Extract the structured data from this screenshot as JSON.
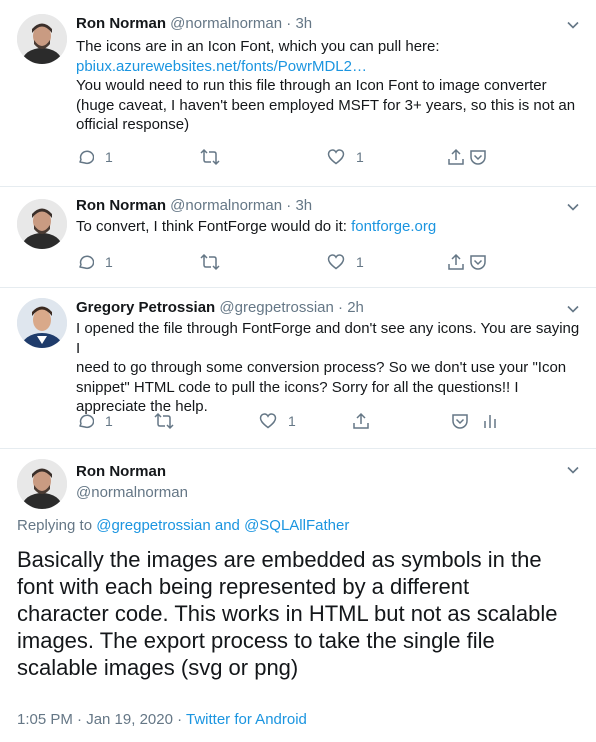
{
  "colors": {
    "link": "#1b95e0",
    "muted": "#657786",
    "text": "#14171a",
    "divider": "#e6ecf0"
  },
  "tweets": [
    {
      "name": "Ron Norman",
      "handle": "@normalnorman",
      "time": "3h",
      "lines": [
        "The icons are in an Icon Font, which you can pull here:",
        "pbiux.azurewebsites.net/fonts/PowrMDL2…",
        "You would need to run this file through an Icon Font to image converter",
        "(huge caveat, I haven't been employed MSFT for 3+ years, so this is not an",
        "official response)"
      ],
      "reply_count": "1",
      "like_count": "1"
    },
    {
      "name": "Ron Norman",
      "handle": "@normalnorman",
      "time": "3h",
      "text_prefix": "To convert, I think FontForge would do it: ",
      "link": "fontforge.org",
      "reply_count": "1",
      "like_count": "1"
    },
    {
      "name": "Gregory Petrossian",
      "handle": "@gregpetrossian",
      "time": "2h",
      "lines": [
        "I opened the file through FontForge and don't see any icons. You are saying I",
        "need to go through some conversion process? So we don't use your \"Icon",
        "snippet\" HTML code to pull the icons? Sorry for all the questions!! I",
        "appreciate the help."
      ],
      "reply_count": "1",
      "like_count": "1"
    }
  ],
  "main_tweet": {
    "name": "Ron Norman",
    "handle": "@normalnorman",
    "replying_prefix": "Replying to ",
    "reply_to_1": "@gregpetrossian",
    "reply_and": " and ",
    "reply_to_2": "@SQLAllFather",
    "lines": [
      "Basically the images are embedded as symbols in the",
      "font with each being represented by a different",
      "character code.  This works in HTML but not as scalable",
      "images.  The export process to take the single file",
      "scalable images (svg or png)"
    ],
    "timestamp": "1:05 PM · Jan 19, 2020",
    "dot": " · ",
    "source": "Twitter for Android"
  }
}
